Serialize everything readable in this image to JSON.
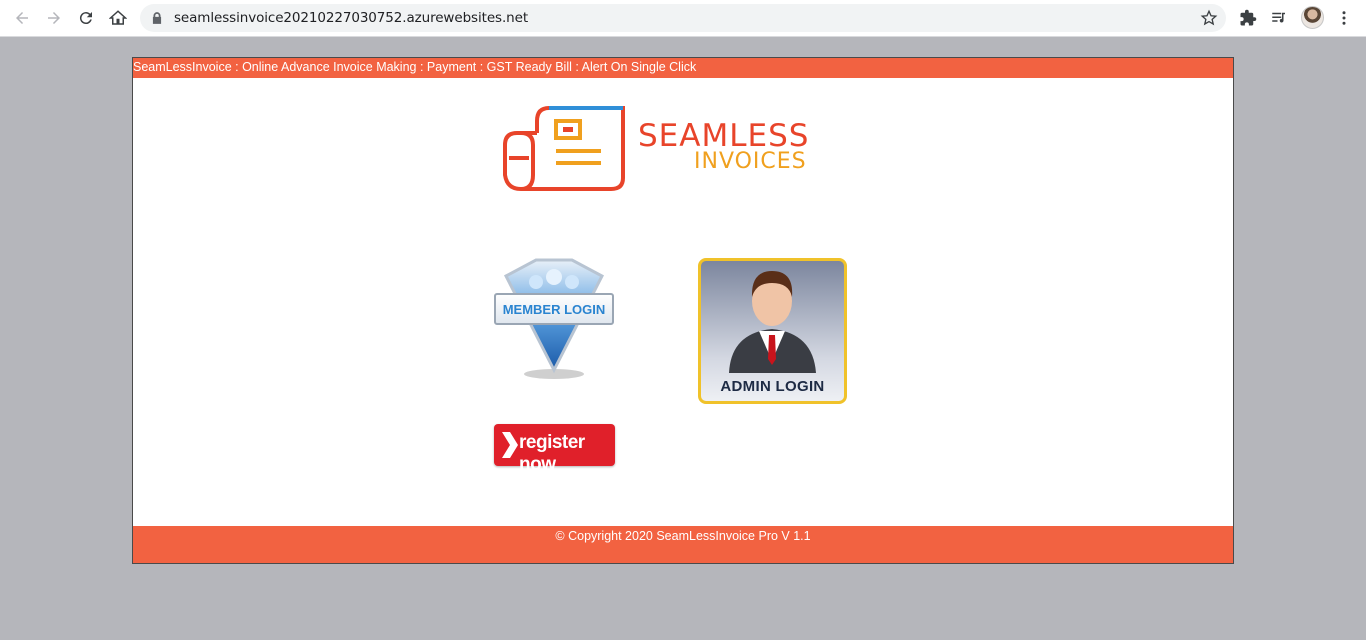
{
  "browser": {
    "url": "seamlessinvoice20210227030752.azurewebsites.net",
    "icons": [
      "back-icon",
      "forward-icon",
      "reload-icon",
      "home-icon",
      "lock-icon",
      "star-icon",
      "extensions-icon",
      "reading-list-icon",
      "profile-avatar",
      "menu-icon"
    ]
  },
  "page": {
    "banner_text": "SeamLessInvoice : Online Advance Invoice Making : Payment : GST Ready Bill : Alert On Single Click",
    "logo": {
      "line1": "SEAMLESS",
      "line2": "INVOICES"
    },
    "member_login_label": "MEMBER LOGIN",
    "admin_login_label": "ADMIN LOGIN",
    "register_label": "register now",
    "footer_text": "© Copyright 2020 SeamLessInvoice Pro V 1.1"
  },
  "colors": {
    "accent": "#f26241",
    "logo_red": "#e8442a",
    "logo_orange": "#f0a01e",
    "register_red": "#e0202a",
    "admin_border": "#f0c22a",
    "page_bg": "#b5b6bb"
  }
}
